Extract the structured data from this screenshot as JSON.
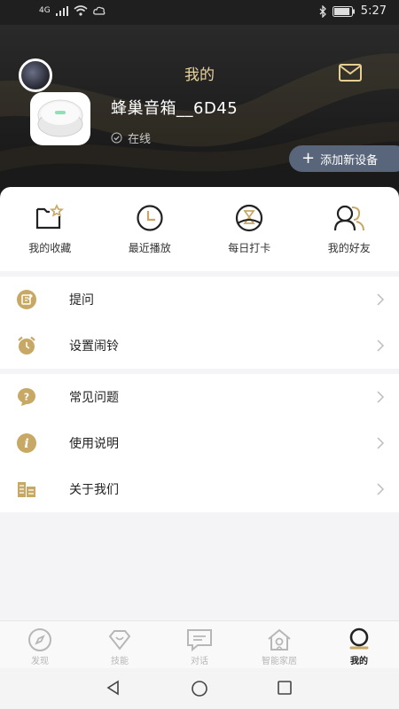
{
  "status_bar": {
    "network": "4G",
    "battery_level": 90,
    "time": "5:27"
  },
  "header": {
    "title": "我的",
    "mail_icon": "mail-icon"
  },
  "device": {
    "name": "蜂巢音箱__6D45",
    "status": "在线",
    "add_button": "添加新设备"
  },
  "quick_actions": [
    {
      "label": "我的收藏",
      "icon": "favorite-folder-icon"
    },
    {
      "label": "最近播放",
      "icon": "clock-icon"
    },
    {
      "label": "每日打卡",
      "icon": "check-in-icon"
    },
    {
      "label": "我的好友",
      "icon": "friends-icon"
    }
  ],
  "menu_group_1": [
    {
      "label": "提问",
      "icon": "question-edit-icon"
    },
    {
      "label": "设置闹铃",
      "icon": "alarm-icon"
    }
  ],
  "menu_group_2": [
    {
      "label": "常见问题",
      "icon": "faq-icon"
    },
    {
      "label": "使用说明",
      "icon": "info-icon"
    },
    {
      "label": "关于我们",
      "icon": "building-icon"
    }
  ],
  "tabs": [
    {
      "label": "发现",
      "icon": "compass-icon",
      "active": false
    },
    {
      "label": "技能",
      "icon": "skill-diamond-icon",
      "active": false
    },
    {
      "label": "对话",
      "icon": "chat-icon",
      "active": false
    },
    {
      "label": "智能家居",
      "icon": "smart-home-icon",
      "active": false
    },
    {
      "label": "我的",
      "icon": "profile-icon",
      "active": true
    }
  ],
  "colors": {
    "accent_gold": "#c7a865",
    "header_bg": "#1e1e1e",
    "button_bg": "#59657a"
  }
}
